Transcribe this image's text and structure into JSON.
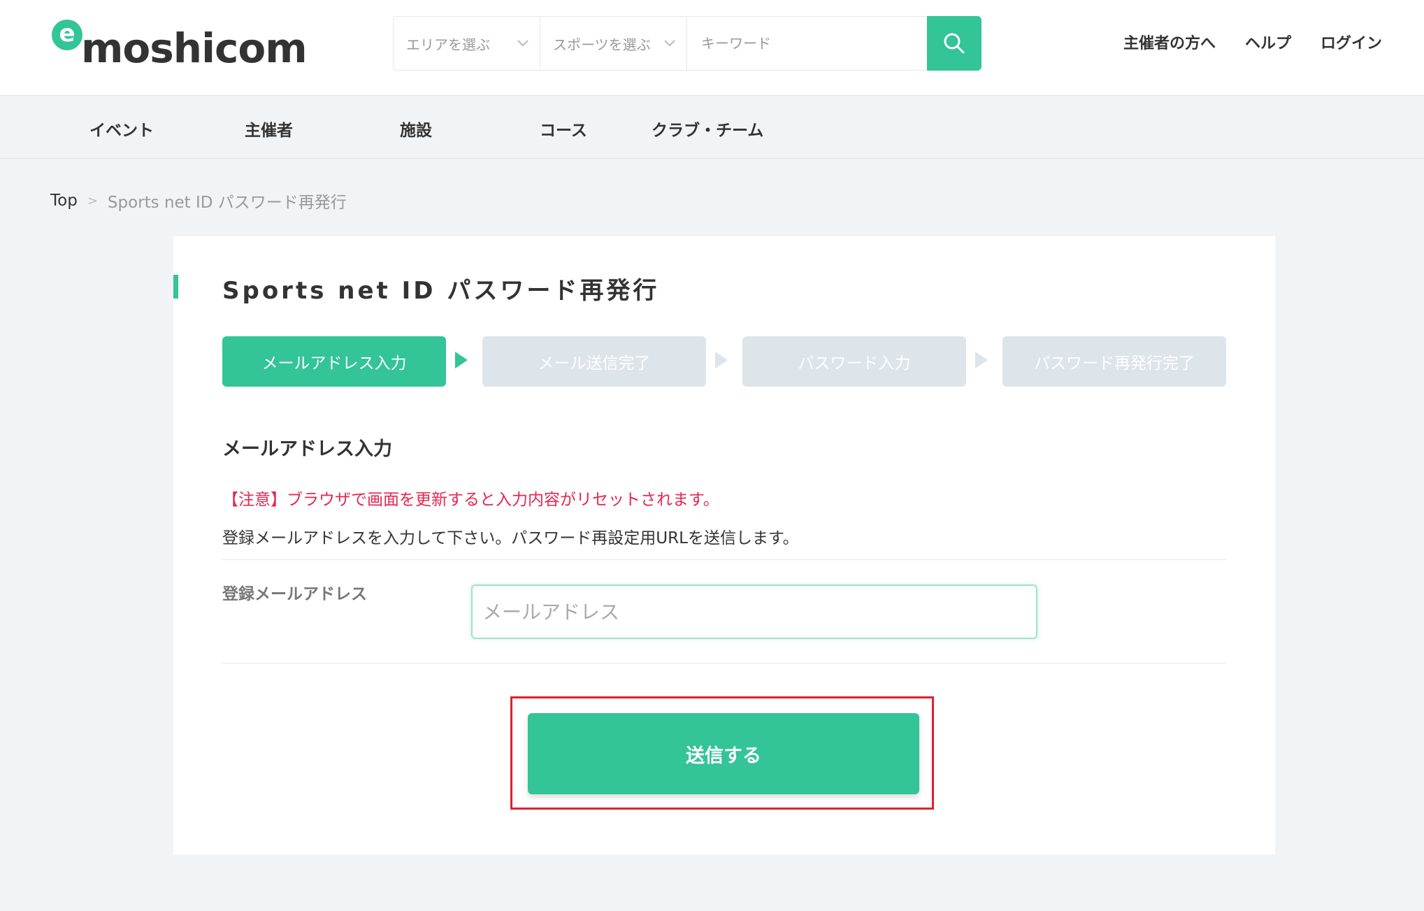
{
  "header": {
    "logo_mark": "e",
    "logo_text": "moshicom",
    "area_select": "エリアを選ぶ",
    "sport_select": "スポーツを選ぶ",
    "keyword_placeholder": "キーワード",
    "links": [
      "主催者の方へ",
      "ヘルプ",
      "ログイン"
    ]
  },
  "nav": {
    "items": [
      "イベント",
      "主催者",
      "施設",
      "コース",
      "クラブ・チーム"
    ]
  },
  "breadcrumb": {
    "top": "Top",
    "separator": ">",
    "current": "Sports net ID パスワード再発行"
  },
  "page": {
    "title": "Sports net ID パスワード再発行",
    "steps": [
      "メールアドレス入力",
      "メール送信完了",
      "パスワード入力",
      "パスワード再発行完了"
    ],
    "active_step": 1,
    "section_title": "メールアドレス入力",
    "warning": "【注意】ブラウザで画面を更新すると入力内容がリセットされます。",
    "description": "登録メールアドレスを入力して下さい。パスワード再設定用URLを送信します。",
    "field_label": "登録メールアドレス",
    "email_placeholder": "メールアドレス",
    "email_value": "",
    "submit_label": "送信する"
  },
  "colors": {
    "accent": "#33c497",
    "warning": "#e6264f",
    "highlight_border": "#e0202f",
    "inactive_step": "#dde4ea"
  },
  "icons": {
    "search": "search-icon",
    "chevron": "chevron-down-icon"
  }
}
